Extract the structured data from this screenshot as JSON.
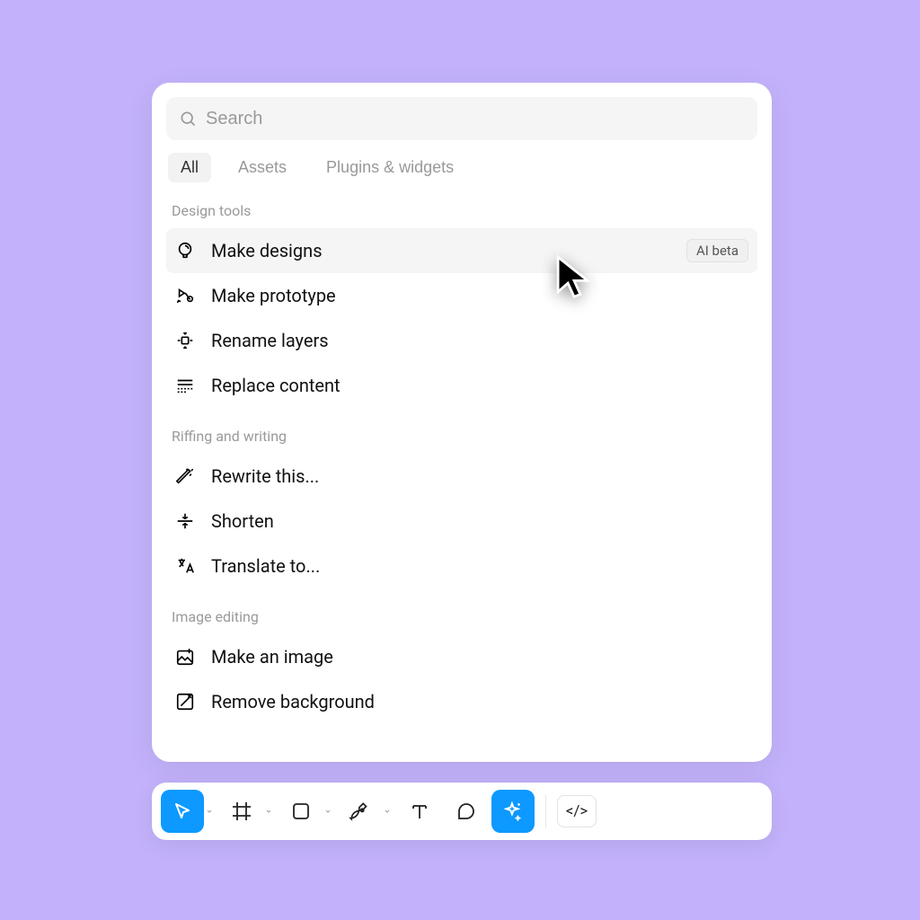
{
  "search": {
    "placeholder": "Search",
    "value": ""
  },
  "tabs": [
    {
      "label": "All",
      "active": true
    },
    {
      "label": "Assets",
      "active": false
    },
    {
      "label": "Plugins & widgets",
      "active": false
    }
  ],
  "sections": [
    {
      "title": "Design tools",
      "items": [
        {
          "icon": "idea-icon",
          "label": "Make designs",
          "badge": "AI beta",
          "highlight": true
        },
        {
          "icon": "prototype-icon",
          "label": "Make prototype"
        },
        {
          "icon": "rename-icon",
          "label": "Rename layers"
        },
        {
          "icon": "replace-icon",
          "label": "Replace content"
        }
      ]
    },
    {
      "title": "Riffing and writing",
      "items": [
        {
          "icon": "magic-icon",
          "label": "Rewrite this..."
        },
        {
          "icon": "shorten-icon",
          "label": "Shorten"
        },
        {
          "icon": "translate-icon",
          "label": "Translate to..."
        }
      ]
    },
    {
      "title": "Image editing",
      "items": [
        {
          "icon": "make-image-icon",
          "label": "Make an image"
        },
        {
          "icon": "remove-bg-icon",
          "label": "Remove background"
        }
      ]
    }
  ],
  "toolbar": {
    "tools": [
      {
        "name": "move-tool",
        "icon": "cursor-outline-icon",
        "active": true,
        "chevron": true
      },
      {
        "name": "frame-tool",
        "icon": "frame-icon",
        "chevron": true
      },
      {
        "name": "rectangle-tool",
        "icon": "rect-icon",
        "chevron": true
      },
      {
        "name": "pen-tool",
        "icon": "pen-icon",
        "chevron": true
      },
      {
        "name": "text-tool",
        "icon": "text-icon"
      },
      {
        "name": "comment-tool",
        "icon": "comment-icon"
      },
      {
        "name": "ai-tool",
        "icon": "sparkle-icon",
        "active": true
      }
    ],
    "dev": {
      "label": "</>"
    }
  }
}
